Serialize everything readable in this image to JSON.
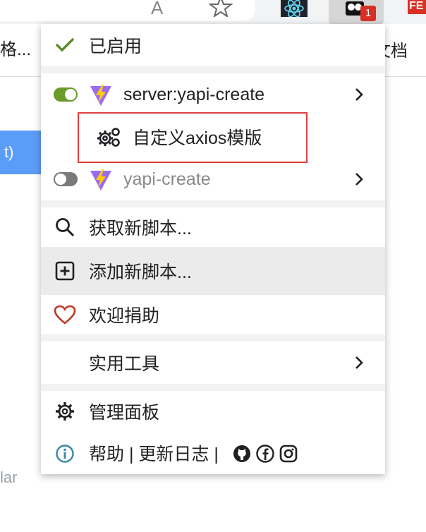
{
  "browser": {
    "read_aloud_glyph": "A",
    "badge_count": "1",
    "fe_label": "FE",
    "bookmark_left": "格...",
    "bookmark_right": "文档",
    "page_tab_text": "t)",
    "page_bottom_text": "lar"
  },
  "menu": {
    "enabled_label": "已启用",
    "scripts": [
      {
        "name": "server:yapi-create",
        "enabled": true
      },
      {
        "name": "yapi-create",
        "enabled": false
      }
    ],
    "script_command": "自定义axios模版",
    "get_new_scripts": "获取新脚本...",
    "add_new_script": "添加新脚本...",
    "donate": "欢迎捐助",
    "utilities": "实用工具",
    "dashboard": "管理面板",
    "footer": "帮助 | 更新日志 |"
  },
  "colors": {
    "toggle_on": "#6a9a2a",
    "toggle_off": "#7a7a7a",
    "check": "#5a8a2a",
    "heart": "#c0392b",
    "highlight_border": "#e03e3e",
    "hover_row": "#ebebeb"
  }
}
